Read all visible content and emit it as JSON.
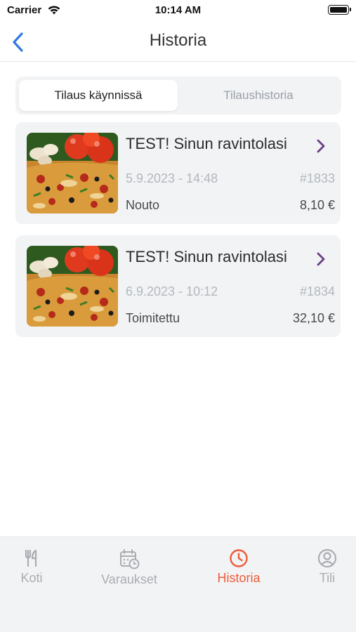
{
  "status_bar": {
    "carrier": "Carrier",
    "time": "10:14 AM"
  },
  "nav": {
    "title": "Historia",
    "back_icon": "chevron-left-icon"
  },
  "segments": {
    "active_label": "Tilaus käynnissä",
    "inactive_label": "Tilaushistoria"
  },
  "orders": [
    {
      "restaurant": "TEST! Sinun ravintolasi",
      "date": "5.9.2023 - 14:48",
      "number": "#1833",
      "status": "Nouto",
      "price": "8,10 €"
    },
    {
      "restaurant": "TEST! Sinun ravintolasi",
      "date": "6.9.2023 - 10:12",
      "number": "#1834",
      "status": "Toimitettu",
      "price": "32,10 €"
    }
  ],
  "tabs": [
    {
      "label": "Koti",
      "icon": "fork-knife-icon",
      "active": false
    },
    {
      "label": "Varaukset",
      "icon": "calendar-clock-icon",
      "active": false
    },
    {
      "label": "Historia",
      "icon": "clock-icon",
      "active": true
    },
    {
      "label": "Tili",
      "icon": "user-circle-icon",
      "active": false
    }
  ],
  "colors": {
    "accent": "#ee5b3b",
    "back_blue": "#2f7ae5",
    "chevron_purple": "#6b3f86",
    "card_bg": "#f1f3f5"
  }
}
